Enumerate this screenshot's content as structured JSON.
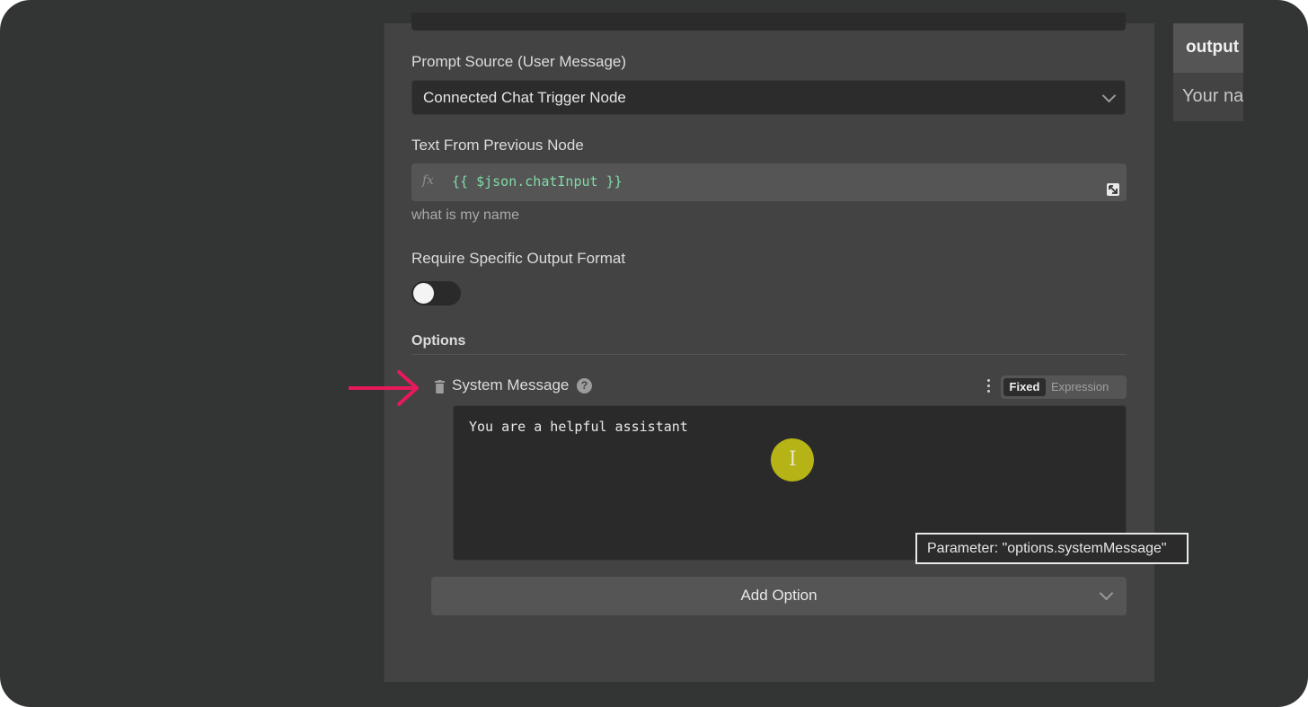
{
  "form": {
    "prompt_source_label": "Prompt Source (User Message)",
    "prompt_source_value": "Connected Chat Trigger Node",
    "text_from_previous_label": "Text From Previous Node",
    "fx_label": "fx",
    "text_from_previous_expression": "{{ $json.chatInput }}",
    "text_from_previous_preview": "what is my name",
    "require_output_format_label": "Require Specific Output Format",
    "require_output_format_enabled": false,
    "options_heading": "Options"
  },
  "system_message": {
    "label": "System Message",
    "help_glyph": "?",
    "mode_fixed": "Fixed",
    "mode_expression": "Expression",
    "mode_selected": "Fixed",
    "value": "You are a helpful assistant",
    "tooltip": "Parameter: \"options.systemMessage\""
  },
  "add_option": {
    "label": "Add Option"
  },
  "output_panel": {
    "title": "output",
    "preview": "Your na"
  },
  "annotation": {
    "arrow_color": "#e8195a",
    "cursor_highlight_color": "#b6b316"
  },
  "icons": {
    "dropdown": "chevron-down-icon",
    "expand": "expand-icon",
    "delete": "trash-icon",
    "help": "help-icon",
    "more": "kebab-icon"
  }
}
